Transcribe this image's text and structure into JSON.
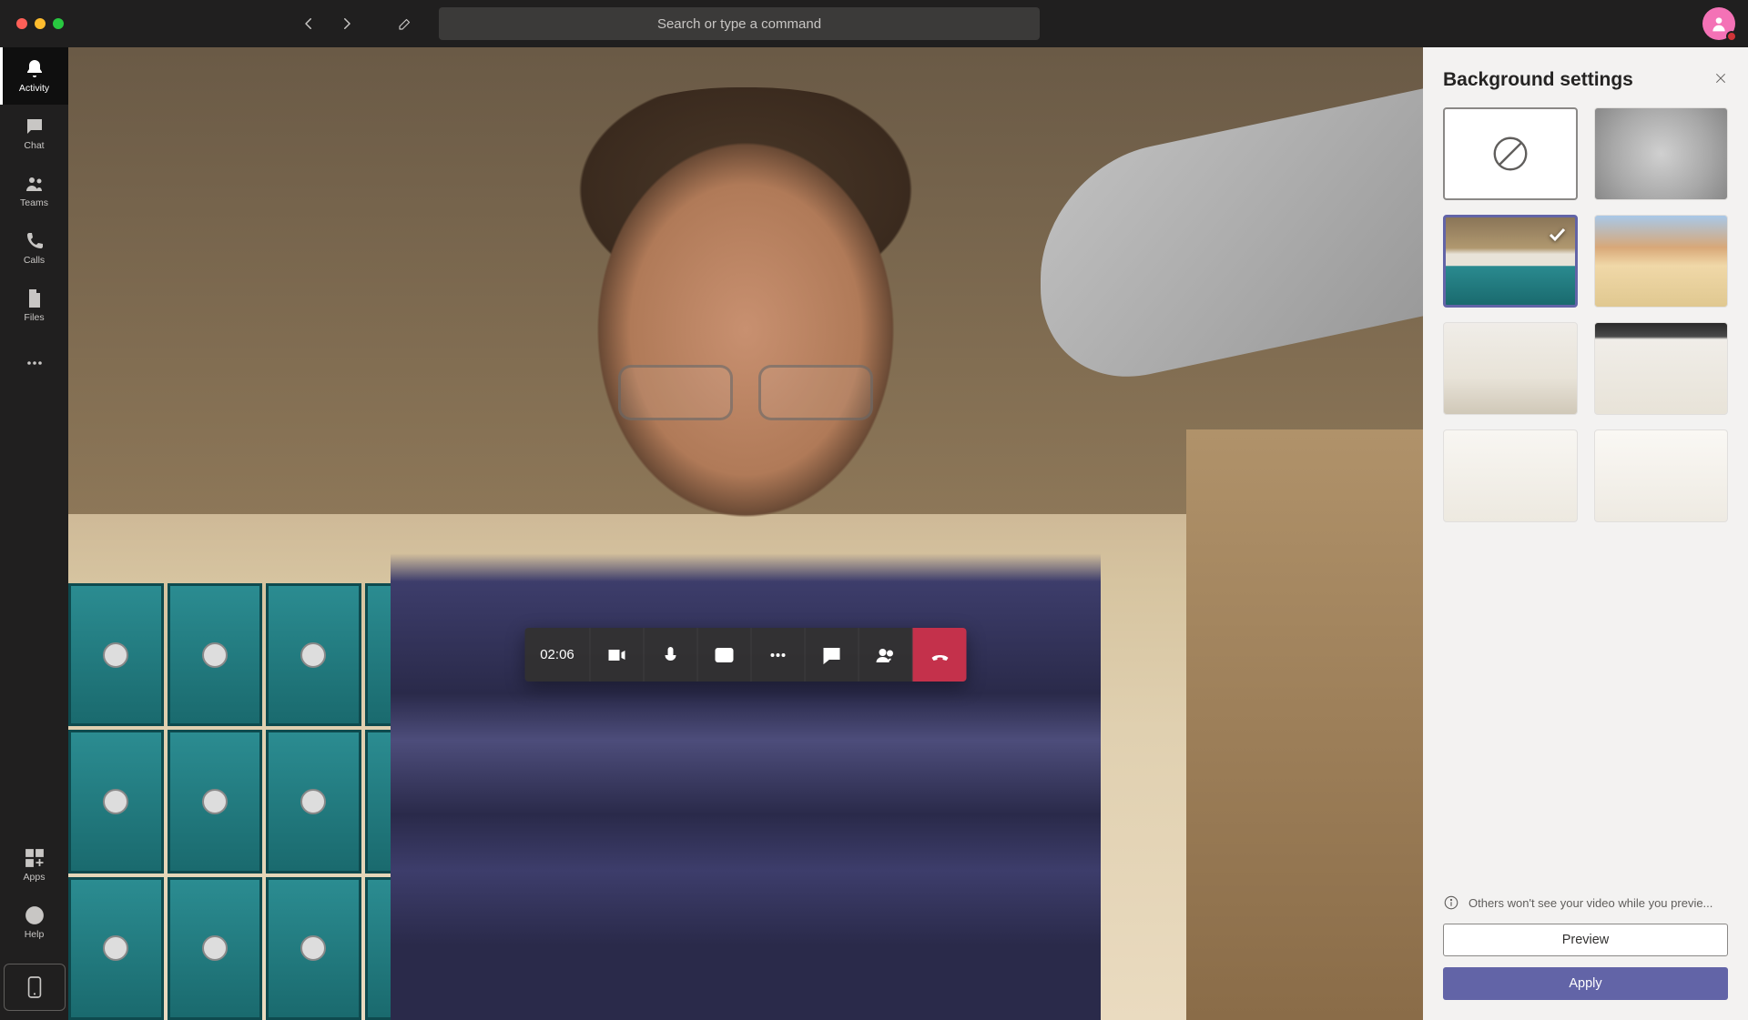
{
  "search": {
    "placeholder": "Search or type a command"
  },
  "rail": {
    "activity": "Activity",
    "chat": "Chat",
    "teams": "Teams",
    "calls": "Calls",
    "files": "Files",
    "apps": "Apps",
    "help": "Help"
  },
  "call": {
    "timer": "02:06"
  },
  "panel": {
    "title": "Background settings",
    "hint": "Others won't see your video while you previe...",
    "preview": "Preview",
    "apply": "Apply",
    "options": {
      "none": "None",
      "blur": "Blur",
      "bg1": "Locker room",
      "bg2": "Beach",
      "bg3": "Modern room 1",
      "bg4": "Modern room 2",
      "bg5": "White studio 1",
      "bg6": "White studio 2"
    },
    "selected_index": 2
  },
  "colors": {
    "accent": "#6264a7",
    "danger": "#c4314b"
  }
}
